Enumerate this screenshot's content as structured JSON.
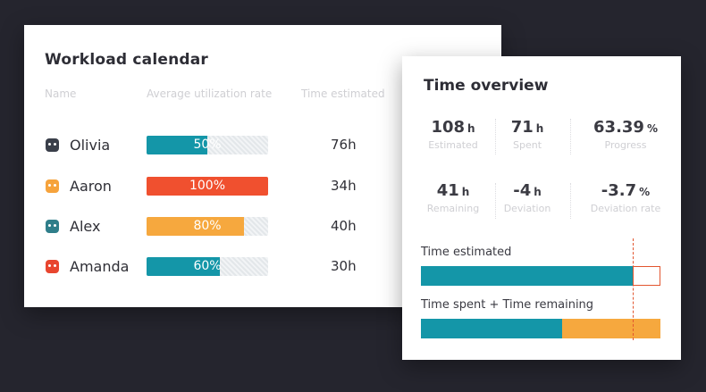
{
  "workload": {
    "title": "Workload calendar",
    "columns": [
      "Name",
      "Average utilization rate",
      "Time estimated"
    ],
    "rows": [
      {
        "name": "Olivia",
        "rate_label": "50%",
        "rate": 0.5,
        "color": "#1496a8",
        "time": "76h",
        "avatar_color": "#3a3f4a"
      },
      {
        "name": "Aaron",
        "rate_label": "100%",
        "rate": 1.0,
        "color": "#f0502f",
        "time": "34h",
        "avatar_color": "#f6a33c"
      },
      {
        "name": "Alex",
        "rate_label": "80%",
        "rate": 0.8,
        "color": "#f6a83e",
        "time": "40h",
        "avatar_color": "#2f7e8a"
      },
      {
        "name": "Amanda",
        "rate_label": "60%",
        "rate": 0.6,
        "color": "#1496a8",
        "time": "30h",
        "avatar_color": "#e8462f"
      }
    ]
  },
  "overview": {
    "title": "Time overview",
    "stats": [
      {
        "value": "108",
        "unit": "h",
        "label": "Estimated"
      },
      {
        "value": "71",
        "unit": "h",
        "label": "Spent"
      },
      {
        "value": "63.39",
        "unit": "%",
        "label": "Progress"
      },
      {
        "value": "41",
        "unit": "h",
        "label": "Remaining"
      },
      {
        "value": "-4",
        "unit": "h",
        "label": "Deviation"
      },
      {
        "value": "-3.7",
        "unit": "%",
        "label": "Deviation rate"
      }
    ],
    "estimated_label": "Time estimated",
    "spent_remaining_label": "Time spent + Time remaining",
    "estimated_fraction": 0.885,
    "spent_fraction": 0.588,
    "remaining_fraction": 0.412,
    "colors": {
      "teal": "#1496a8",
      "orange": "#f6a83e",
      "deviation": "#e2552f"
    }
  }
}
